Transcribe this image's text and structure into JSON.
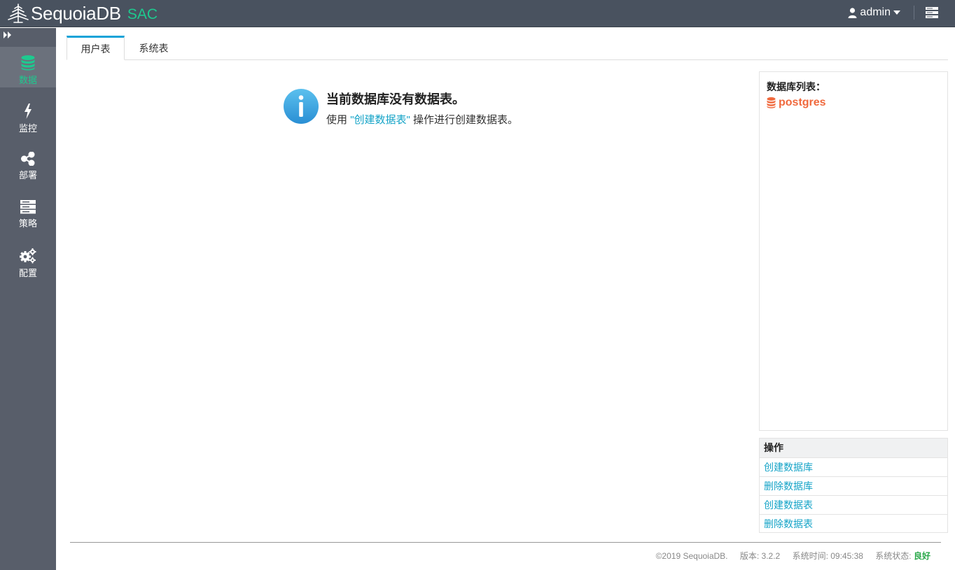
{
  "app": {
    "name": "SequoiaDB",
    "suffix": "SAC",
    "user": "admin"
  },
  "sidebar": {
    "items": [
      {
        "label": "数据",
        "icon": "database-icon",
        "active": true
      },
      {
        "label": "监控",
        "icon": "lightning-icon",
        "active": false
      },
      {
        "label": "部署",
        "icon": "share-icon",
        "active": false
      },
      {
        "label": "策略",
        "icon": "server-icon",
        "active": false
      },
      {
        "label": "配置",
        "icon": "gears-icon",
        "active": false
      }
    ]
  },
  "tabs": [
    {
      "label": "用户表",
      "active": true
    },
    {
      "label": "系统表",
      "active": false
    }
  ],
  "notice": {
    "title": "当前数据库没有数据表。",
    "prefix": "使用",
    "link": "\"创建数据表\"",
    "suffix": "操作进行创建数据表。"
  },
  "db_list": {
    "title": "数据库列表：",
    "items": [
      "postgres"
    ]
  },
  "operations": {
    "title": "操作",
    "items": [
      "创建数据库",
      "删除数据库",
      "创建数据表",
      "删除数据表"
    ]
  },
  "footer": {
    "copyright": "©2019 SequoiaDB.",
    "version": "版本: 3.2.2",
    "time": "系统时间: 09:45:38",
    "status_label": "系统状态:",
    "status_value": "良好"
  },
  "colors": {
    "topbar": "#49525f",
    "sidebar": "#585e6a",
    "accent_green": "#1ec98f",
    "link_blue": "#14a3c7",
    "db_orange": "#f0693d",
    "tab_active_border": "#14a3d8"
  }
}
